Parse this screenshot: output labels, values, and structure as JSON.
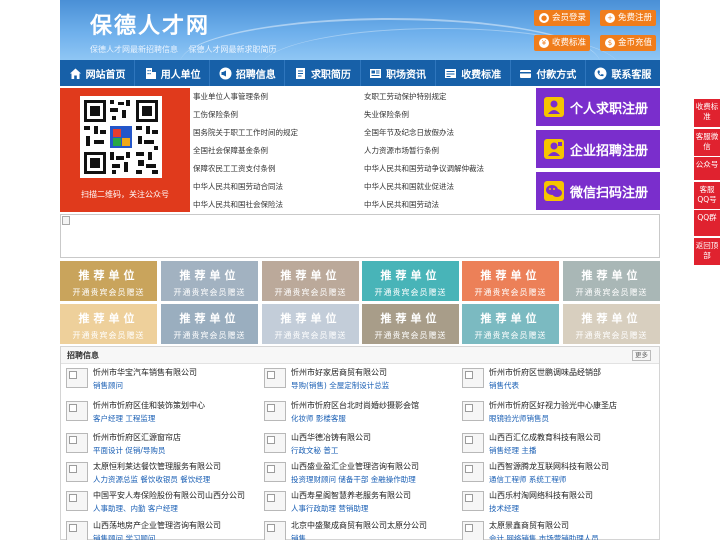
{
  "header": {
    "site_title": "保德人才网",
    "slogan1": "保德人才网最新招聘信息",
    "slogan2": "保德人才网最新求职简历",
    "buttons": {
      "member_login": "会员登录",
      "free_register": "免费注册",
      "fee_standard": "收费标准",
      "coin_recharge": "金币充值"
    }
  },
  "nav": {
    "items": [
      "网站首页",
      "用人单位",
      "招聘信息",
      "求职简历",
      "职场资讯",
      "收费标准",
      "付款方式",
      "联系客服"
    ]
  },
  "qr": {
    "caption": "扫描二维码，关注公众号"
  },
  "links": {
    "left": [
      "事业单位人事管理条例",
      "工伤保险条例",
      "国务院关于职工工作时间的规定",
      "全国社会保障基金条例",
      "保障农民工工资支付条例",
      "中华人民共和国劳动合同法",
      "中华人民共和国社会保险法"
    ],
    "right": [
      "女职工劳动保护特别规定",
      "失业保险条例",
      "全国年节及纪念日放假办法",
      "人力资源市场暂行条例",
      "中华人民共和国劳动争议调解仲裁法",
      "中华人民共和国就业促进法",
      "中华人民共和国劳动法"
    ]
  },
  "register": {
    "personal": "个人求职注册",
    "company": "企业招聘注册",
    "wechat": "微信扫码注册"
  },
  "tiles": {
    "title": "推荐单位",
    "subtitle": "开通贵宾会员赠送",
    "colors": [
      "#c9a45c",
      "#a2b2c1",
      "#bba99a",
      "#48b4b8",
      "#ec8058",
      "#a9b7b6",
      "#eed09b",
      "#9aaebf",
      "#c3cdd9",
      "#a89d89",
      "#7bbac1",
      "#d8cfbf"
    ]
  },
  "jobs": {
    "title": "招聘信息",
    "more": "更多",
    "items": [
      {
        "company": "忻州市华宝汽车销售有限公司",
        "positions": "销售顾问"
      },
      {
        "company": "忻州市好家居商贸有限公司",
        "positions": "导购(销售) 全屋定制设计总监"
      },
      {
        "company": "忻州市忻府区世鹏调味品经销部",
        "positions": "销售代表"
      },
      {
        "company": "忻州市忻府区佳和装饰策划中心",
        "positions": "客户经理 工程监理"
      },
      {
        "company": "忻州市忻府区台北时尚婚纱摄影会馆",
        "positions": "化妆师 影楼客服"
      },
      {
        "company": "忻州市忻府区好视力验光中心康圣店",
        "positions": "眼镜验光师销售员"
      },
      {
        "company": "忻州市忻府区汇源窗帘店",
        "positions": "平面设计 促销/导购员"
      },
      {
        "company": "山西华德冶铸有限公司",
        "positions": "行政文秘 普工"
      },
      {
        "company": "山西百汇亿成教育科技有限公司",
        "positions": "销售经理 主播"
      },
      {
        "company": "太原恒利莱达餐饮管理服务有限公司",
        "positions": "人力资源总监 餐饮收银员 餐饮经理"
      },
      {
        "company": "山西盛业盈汇企业管理咨询有限公司",
        "positions": "投资理财顾问 储备干部 金融操作助理"
      },
      {
        "company": "山西智源腾龙互联网科技有限公司",
        "positions": "通信工程师 系统工程师"
      },
      {
        "company": "中国平安人寿保险股份有限公司山西分公司",
        "positions": "人事助理、内勤 客户经理"
      },
      {
        "company": "山西寿星阁智慧养老服务有限公司",
        "positions": "人事行政助理 营销助理"
      },
      {
        "company": "山西乐村淘网络科技有限公司",
        "positions": "技术经理"
      },
      {
        "company": "山西荡地房产企业管理咨询有限公司",
        "positions": "销售顾问 学习顾问"
      },
      {
        "company": "北京中盛聚成商贸有限公司太原分公司",
        "positions": "销售"
      },
      {
        "company": "太原景鑫商贸有限公司",
        "positions": "会计 网络销售 市场营销助理人员"
      }
    ]
  },
  "side": {
    "items": [
      "收费标准",
      "客服微信",
      "公众号",
      "客服QQ号",
      "QQ群",
      "返回顶部"
    ]
  },
  "colors": {
    "nav": "#1760a8",
    "orange_button": "#f07d1c",
    "register_purple": "#7a2ecc",
    "qr_red": "#e03a1c",
    "side_red": "#e0222f"
  }
}
